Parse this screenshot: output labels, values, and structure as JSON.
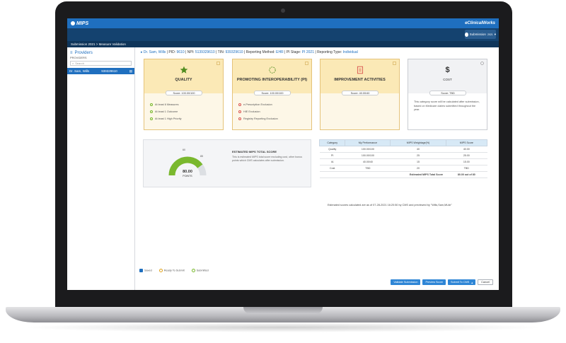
{
  "app": {
    "brand": "MIPS",
    "vendor": "eClinicalWorks",
    "submission_button": "Submission",
    "submission_sub": "2021"
  },
  "breadcrumb": "Submission 2021  >  Measure Validation",
  "sidebar": {
    "title": "Providers",
    "label": "PROVIDERS",
    "search_placeholder": "Search",
    "selected_provider": {
      "name": "Dr. Sam, Wills",
      "tin": "939329610"
    }
  },
  "provider_bar": {
    "name": "Dr. Sam, Wills",
    "pid_label": "PID:",
    "pid": "9610",
    "npi_label": "NPI:",
    "npi": "5139329610",
    "tin_label": "TIN:",
    "tin": "939329610",
    "method_label": "Reporting Method:",
    "method": "EHR",
    "pi_stage_label": "PI Stage:",
    "pi_stage": "PI 2021",
    "type_label": "Reporting Type:",
    "type": "Individual"
  },
  "categories": [
    {
      "title": "QUALITY",
      "score": "Score: 100.00/100",
      "items": [
        "At least 6 Measures",
        "At least 1 Outcome",
        "At least 1 High Priority"
      ]
    },
    {
      "title": "PROMOTING INTEROPERABILITY (PI)",
      "score": "Score: 100.00/100",
      "items": [
        "e-Prescription Exclusion",
        "HIE Exclusion",
        "Registry Reporting Exclusion"
      ]
    },
    {
      "title": "IMPROVEMENT ACTIVITIES",
      "score": "Score: 40.00/40"
    },
    {
      "title": "COST",
      "score": "Score: TBD",
      "description": "This category score will be calculated after submission, based on Medicare claims submitted throughout the year."
    }
  ],
  "estimate": {
    "gauge_value": "80.00",
    "gauge_unit": "POINTS",
    "gauge_low": "60",
    "gauge_high": "85",
    "gauge_fraction": 0.8,
    "title": "ESTIMATED MIPS TOTAL SCORE",
    "description": "This is estimated MIPS total score excluding cost, other bonus points which CMS calculates after submission."
  },
  "score_table": {
    "headers": [
      "Category",
      "My Performance",
      "MIPS Weightage(%)",
      "MIPS Score"
    ],
    "rows": [
      [
        "Quality",
        "100.00/100",
        "40",
        "40.00"
      ],
      [
        "PI",
        "100.00/100",
        "25",
        "25.00"
      ],
      [
        "IA",
        "40.00/40",
        "15",
        "15.00"
      ],
      [
        "Cost",
        "TBD",
        "20",
        "TBD"
      ]
    ],
    "total_label": "Estimated MIPS Total Score",
    "total_value": "80.00 out of 80"
  },
  "estimate_note": "Estimated scores calculated are as of 07-28-2021 16:20:50 by CMS and previewed by \"Wills,Sam,MUdr\"",
  "legend": [
    "Saved",
    "Ready To Submit",
    "Submitted"
  ],
  "actions": {
    "validate": "Validate Submission",
    "preview": "Preview Score",
    "submit": "Submit To CMS",
    "cancel": "Cancel"
  },
  "colors": {
    "primary": "#1f6fbf",
    "header_dark": "#14426f",
    "card_yellow": "#fbe9b6",
    "gauge_green": "#7ab82e"
  }
}
